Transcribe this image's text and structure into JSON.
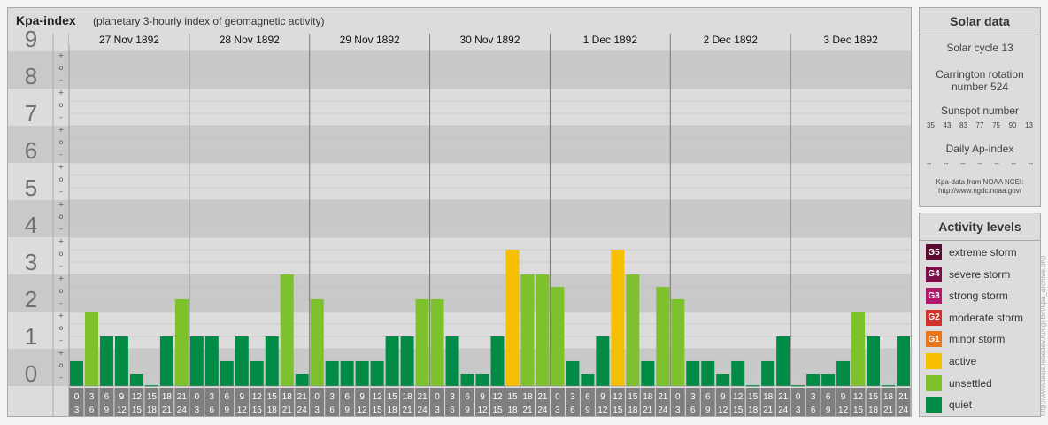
{
  "header": {
    "title": "Kpa-index",
    "subtitle": "(planetary 3-hourly index of geomagnetic activity)"
  },
  "chart_data": {
    "type": "bar",
    "title": "Kpa-index",
    "subtitle": "(planetary 3-hourly index of geomagnetic activity)",
    "ylim": [
      0,
      9
    ],
    "y_ticks": [
      "0",
      "1",
      "2",
      "3",
      "4",
      "5",
      "6",
      "7",
      "8",
      "9"
    ],
    "minor_tick_labels": [
      "+",
      "o",
      "–"
    ],
    "days": [
      "27 Nov 1892",
      "28 Nov 1892",
      "29 Nov 1892",
      "30 Nov 1892",
      "1 Dec 1892",
      "2 Dec 1892",
      "3 Dec 1892"
    ],
    "interval_labels": [
      [
        "0",
        "3"
      ],
      [
        "3",
        "6"
      ],
      [
        "6",
        "9"
      ],
      [
        "9",
        "12"
      ],
      [
        "12",
        "15"
      ],
      [
        "15",
        "18"
      ],
      [
        "18",
        "21"
      ],
      [
        "21",
        "24"
      ]
    ],
    "values": [
      [
        0.667,
        2.0,
        1.333,
        1.333,
        0.333,
        0.0,
        1.333,
        2.333
      ],
      [
        1.333,
        1.333,
        0.667,
        1.333,
        0.667,
        1.333,
        3.0,
        0.333
      ],
      [
        2.333,
        0.667,
        0.667,
        0.667,
        0.667,
        1.333,
        1.333,
        2.333
      ],
      [
        2.333,
        1.333,
        0.333,
        0.333,
        1.333,
        3.667,
        3.0,
        3.0
      ],
      [
        2.667,
        0.667,
        0.333,
        1.333,
        3.667,
        3.0,
        0.667,
        2.667
      ],
      [
        2.333,
        0.667,
        0.667,
        0.333,
        0.667,
        0.0,
        0.667,
        1.333
      ],
      [
        0.0,
        0.333,
        0.333,
        0.667,
        2.0,
        1.333,
        0.0,
        1.333
      ]
    ],
    "grid": true
  },
  "solar_panel": {
    "title": "Solar data",
    "cycle": "Solar cycle 13",
    "carrington_1": "Carrington rotation",
    "carrington_2": "number 524",
    "sunspot_label": "Sunspot number",
    "sunspot_values": [
      "35",
      "43",
      "83",
      "77",
      "75",
      "90",
      "13"
    ],
    "ap_label": "Daily Ap-index",
    "ap_values": [
      "--",
      "--",
      "--",
      "--",
      "--",
      "--",
      "--"
    ],
    "note_1": "Kpa-data from NOAA NCEI:",
    "note_2": "http://www.ngdc.noaa.gov/"
  },
  "levels_panel": {
    "title": "Activity levels",
    "items": [
      {
        "badge": "G5",
        "label": "extreme storm",
        "color": "#5a0a2e"
      },
      {
        "badge": "G4",
        "label": "severe storm",
        "color": "#7a0e48"
      },
      {
        "badge": "G3",
        "label": "strong storm",
        "color": "#b4166c"
      },
      {
        "badge": "G2",
        "label": "moderate storm",
        "color": "#d2322c"
      },
      {
        "badge": "G1",
        "label": "minor storm",
        "color": "#e9761a"
      },
      {
        "badge": "",
        "label": "active",
        "color": "#f6c000"
      },
      {
        "badge": "",
        "label": "unsettled",
        "color": "#7dc12c"
      },
      {
        "badge": "",
        "label": "quiet",
        "color": "#008c46"
      }
    ]
  },
  "watermark": "http://www.tesis.lebedev.ru/cgi-bin/kpa_archive.php",
  "colors": {
    "quiet": "#008c46",
    "unsettled": "#7dc12c",
    "active": "#f6c000",
    "band_dark": "#c9c9c9",
    "band_light": "#dcdcdc",
    "axis_num": "#707070",
    "interval_box": "#7f7f7f"
  }
}
